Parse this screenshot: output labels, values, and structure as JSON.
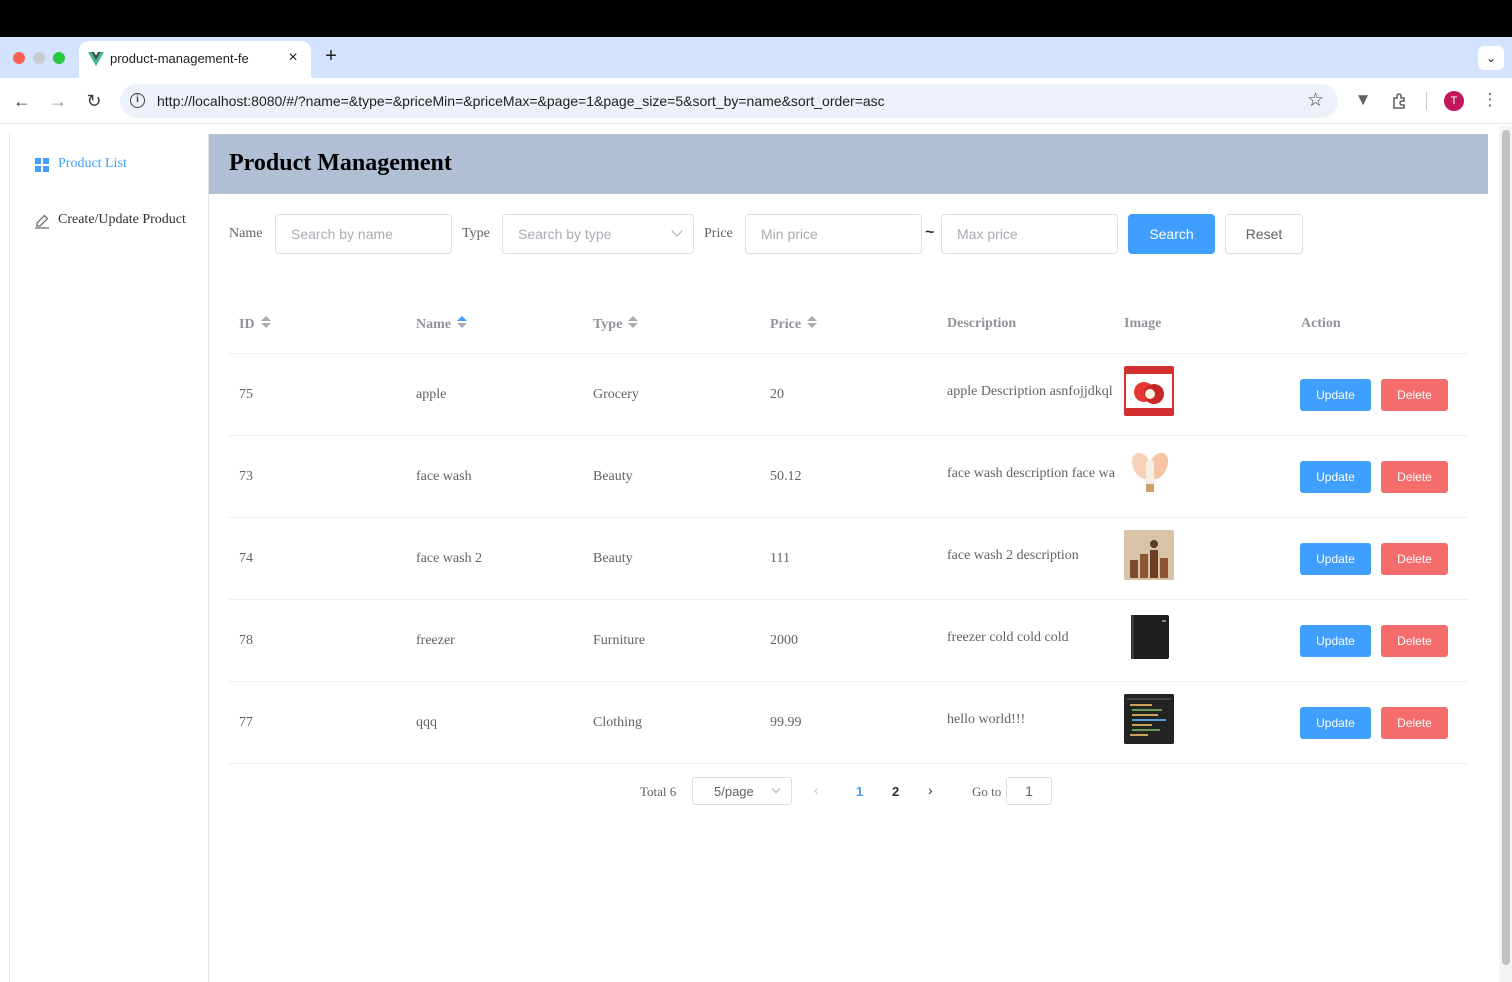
{
  "browser": {
    "tab_title": "product-management-fe",
    "new_tab_symbol": "+",
    "close_symbol": "×",
    "url": "http://localhost:8080/#/?name=&type=&priceMin=&priceMax=&page=1&page_size=5&sort_by=name&sort_order=asc",
    "avatar_letter": "T"
  },
  "sidebar": {
    "items": [
      {
        "label": "Product List",
        "icon": "grid-icon",
        "active": true
      },
      {
        "label": "Create/Update Product",
        "icon": "edit-icon",
        "active": false
      }
    ]
  },
  "header": {
    "title": "Product Management"
  },
  "filters": {
    "name_label": "Name",
    "name_placeholder": "Search by name",
    "type_label": "Type",
    "type_placeholder": "Search by type",
    "price_label": "Price",
    "min_placeholder": "Min price",
    "separator": "~",
    "max_placeholder": "Max price",
    "search_button": "Search",
    "reset_button": "Reset"
  },
  "table": {
    "columns": [
      "ID",
      "Name",
      "Type",
      "Price",
      "Description",
      "Image",
      "Action"
    ],
    "sort": {
      "column": "Name",
      "order": "asc"
    },
    "update_label": "Update",
    "delete_label": "Delete",
    "rows": [
      {
        "id": "75",
        "name": "apple",
        "type": "Grocery",
        "price": "20",
        "description": "apple Description asnfojjdkql",
        "image": "apple-photo"
      },
      {
        "id": "73",
        "name": "face wash",
        "type": "Beauty",
        "price": "50.12",
        "description": "face wash description face wa",
        "image": "cream-photo"
      },
      {
        "id": "74",
        "name": "face wash 2",
        "type": "Beauty",
        "price": "111",
        "description": "face wash 2 description",
        "image": "bottles-photo"
      },
      {
        "id": "78",
        "name": "freezer",
        "type": "Furniture",
        "price": "2000",
        "description": "freezer cold cold cold",
        "image": "freezer-photo"
      },
      {
        "id": "77",
        "name": "qqq",
        "type": "Clothing",
        "price": "99.99",
        "description": "hello world!!!",
        "image": "code-screenshot"
      }
    ]
  },
  "pagination": {
    "total_label": "Total 6",
    "page_size": "5/page",
    "pages": [
      "1",
      "2"
    ],
    "current_page": "1",
    "goto_label": "Go to",
    "goto_value": "1"
  },
  "colors": {
    "primary": "#409eff",
    "danger": "#f56c6c",
    "header_bg": "#b0bfd3"
  }
}
